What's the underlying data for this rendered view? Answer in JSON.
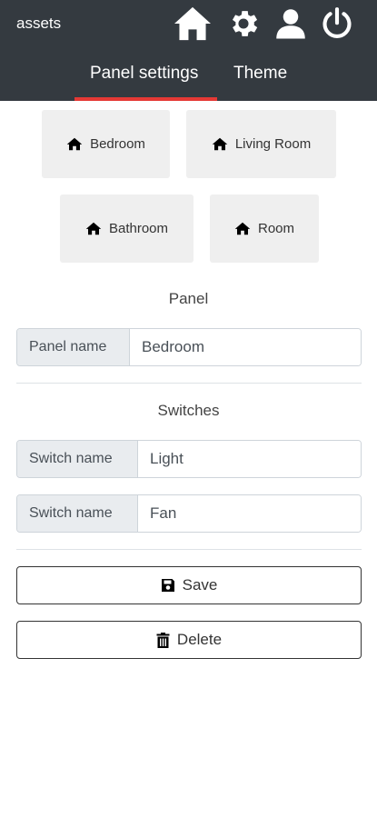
{
  "app": {
    "title": "assets"
  },
  "header": {
    "icons": [
      "home-icon",
      "gear-icon",
      "user-icon",
      "power-icon"
    ],
    "tabs": [
      {
        "label": "Panel settings",
        "active": true
      },
      {
        "label": "Theme",
        "active": false
      }
    ],
    "accent_color": "#e53935",
    "background_color": "#343a40"
  },
  "panels": [
    {
      "label": "Bedroom",
      "icon": "home-icon"
    },
    {
      "label": "Living Room",
      "icon": "home-icon"
    },
    {
      "label": "Bathroom",
      "icon": "home-icon"
    },
    {
      "label": "Room",
      "icon": "home-icon"
    }
  ],
  "panel_section": {
    "title": "Panel",
    "field_label": "Panel name",
    "field_value": "Bedroom"
  },
  "switches_section": {
    "title": "Switches",
    "items": [
      {
        "label": "Switch name",
        "value": "Light"
      },
      {
        "label": "Switch name",
        "value": "Fan"
      }
    ]
  },
  "actions": {
    "save_label": "Save",
    "save_icon": "floppy-disk-icon",
    "delete_label": "Delete",
    "delete_icon": "trash-icon"
  }
}
